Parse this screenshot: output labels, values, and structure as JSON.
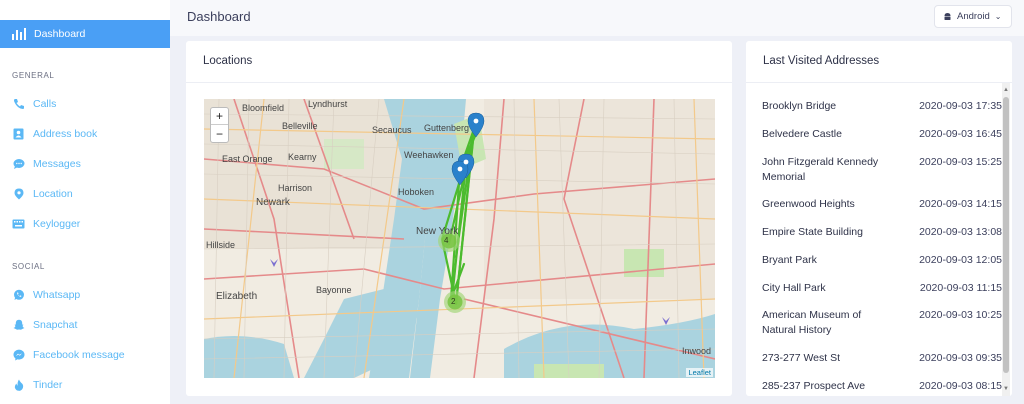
{
  "sidebar": {
    "active_item": "Dashboard",
    "sections": {
      "general": "GENERAL",
      "social": "SOCIAL"
    },
    "general_items": [
      "Calls",
      "Address book",
      "Messages",
      "Location",
      "Keylogger"
    ],
    "social_items": [
      "Whatsapp",
      "Snapchat",
      "Facebook message",
      "Tinder"
    ]
  },
  "header": {
    "title": "Dashboard",
    "os_select": "Android"
  },
  "locations": {
    "title": "Locations",
    "zoom_in": "+",
    "zoom_out": "−",
    "attribution": "Leaflet",
    "cluster_counts": [
      "4",
      "2"
    ],
    "map_labels": [
      "Newark",
      "New York",
      "Elizabeth",
      "Bayonne",
      "Hoboken",
      "Secaucus",
      "Kearny",
      "Belleville",
      "Bloomfield",
      "Lyndhurst",
      "Weehawken",
      "Guttenberg",
      "Inwood",
      "Harrison",
      "East Orange",
      "Hillside"
    ]
  },
  "addresses": {
    "title": "Last Visited Addresses",
    "rows": [
      {
        "name": "Brooklyn Bridge",
        "time": "2020-09-03 17:35"
      },
      {
        "name": "Belvedere Castle",
        "time": "2020-09-03 16:45"
      },
      {
        "name": "John Fitzgerald Kennedy Memorial",
        "time": "2020-09-03 15:25"
      },
      {
        "name": "Greenwood Heights",
        "time": "2020-09-03 14:15"
      },
      {
        "name": "Empire State Building",
        "time": "2020-09-03 13:08"
      },
      {
        "name": "Bryant Park",
        "time": "2020-09-03 12:05"
      },
      {
        "name": "City Hall Park",
        "time": "2020-09-03 11:15"
      },
      {
        "name": "American Museum of Natural History",
        "time": "2020-09-03 10:25"
      },
      {
        "name": "273-277 West St",
        "time": "2020-09-03 09:35"
      },
      {
        "name": "285-237 Prospect Ave",
        "time": "2020-09-03 08:15"
      }
    ]
  }
}
